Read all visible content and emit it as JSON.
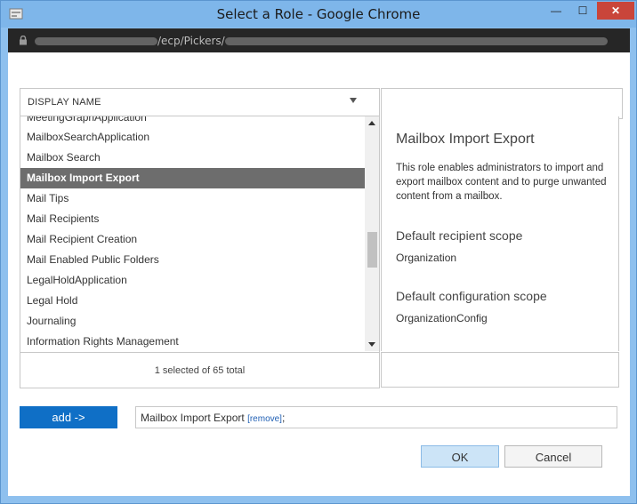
{
  "window": {
    "title": "Select a Role - Google Chrome",
    "min_label": "—",
    "max_label": "☐",
    "close_label": "✕"
  },
  "address_bar": {
    "url_visible": "/ecp/Pickers/"
  },
  "list": {
    "header_label": "DISPLAY NAME",
    "items": [
      {
        "label": "MeetingGraphApplication",
        "selected": false
      },
      {
        "label": "MailboxSearchApplication",
        "selected": false
      },
      {
        "label": "Mailbox Search",
        "selected": false
      },
      {
        "label": "Mailbox Import Export",
        "selected": true
      },
      {
        "label": "Mail Tips",
        "selected": false
      },
      {
        "label": "Mail Recipients",
        "selected": false
      },
      {
        "label": "Mail Recipient Creation",
        "selected": false
      },
      {
        "label": "Mail Enabled Public Folders",
        "selected": false
      },
      {
        "label": "LegalHoldApplication",
        "selected": false
      },
      {
        "label": "Legal Hold",
        "selected": false
      },
      {
        "label": "Journaling",
        "selected": false
      },
      {
        "label": "Information Rights Management",
        "selected": false
      }
    ],
    "status": "1 selected of 65 total"
  },
  "search": {
    "value": ""
  },
  "details": {
    "title": "Mailbox Import Export",
    "description": "This role enables administrators to import and export mailbox content and to purge unwanted content from a mailbox.",
    "recipient_scope_heading": "Default recipient scope",
    "recipient_scope_value": "Organization",
    "config_scope_heading": "Default configuration scope",
    "config_scope_value": "OrganizationConfig"
  },
  "selection": {
    "add_label": "add ->",
    "selected_role": "Mailbox Import Export",
    "remove_label": "[remove]",
    "separator": ";"
  },
  "buttons": {
    "ok_label": "OK",
    "cancel_label": "Cancel"
  },
  "colors": {
    "accent": "#0f6fc6",
    "selected_row": "#6d6d6d",
    "titlebar": "#7eb6ea"
  }
}
